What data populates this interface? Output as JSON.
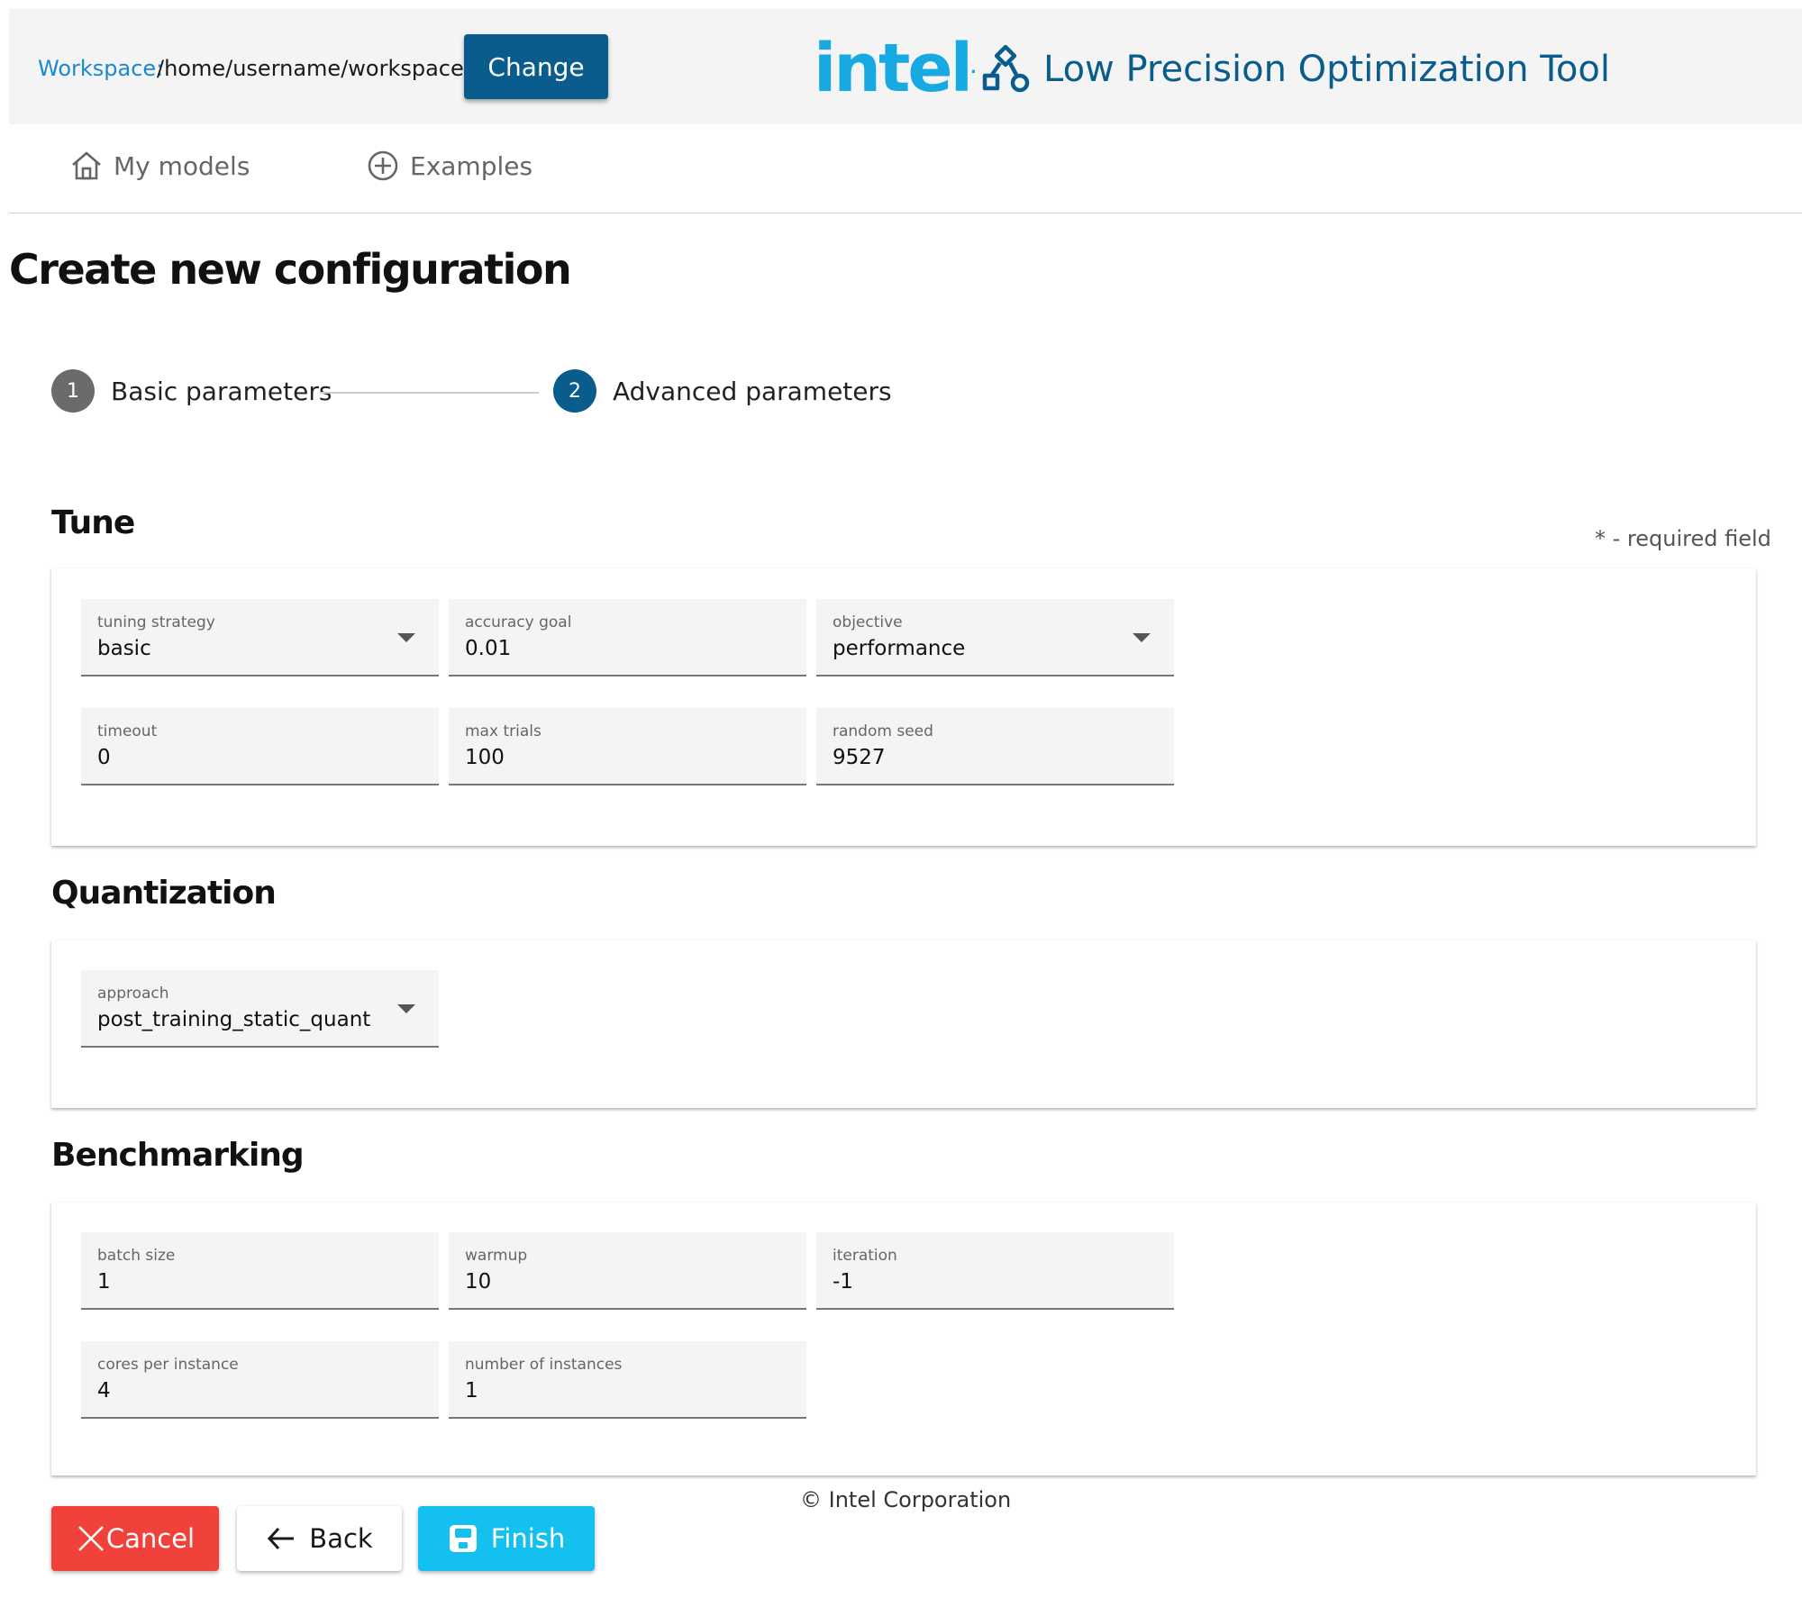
{
  "header": {
    "workspace_label": "Workspace:",
    "workspace_path": "/home/username/workspace",
    "change_label": "Change",
    "brand_logo": "intel",
    "app_title": "Low Precision Optimization Tool",
    "app_icon": "shapes-icon"
  },
  "nav": {
    "items": [
      {
        "label": "My models",
        "icon": "home-icon"
      },
      {
        "label": "Examples",
        "icon": "plus-circle-icon"
      }
    ]
  },
  "page": {
    "title": "Create new configuration",
    "required_note": "* - required field"
  },
  "stepper": {
    "steps": [
      {
        "number": "1",
        "label": "Basic parameters",
        "state": "inactive"
      },
      {
        "number": "2",
        "label": "Advanced parameters",
        "state": "active"
      }
    ]
  },
  "sections": {
    "tune": {
      "title": "Tune",
      "fields": {
        "tuning_strategy": {
          "label": "tuning strategy",
          "value": "basic",
          "type": "select"
        },
        "accuracy_goal": {
          "label": "accuracy goal",
          "value": "0.01",
          "type": "text"
        },
        "objective": {
          "label": "objective",
          "value": "performance",
          "type": "select"
        },
        "timeout": {
          "label": "timeout",
          "value": "0",
          "type": "text"
        },
        "max_trials": {
          "label": "max trials",
          "value": "100",
          "type": "text"
        },
        "random_seed": {
          "label": "random seed",
          "value": "9527",
          "type": "text"
        }
      }
    },
    "quantization": {
      "title": "Quantization",
      "fields": {
        "approach": {
          "label": "approach",
          "value": "post_training_static_quant",
          "type": "select"
        }
      }
    },
    "benchmarking": {
      "title": "Benchmarking",
      "fields": {
        "batch_size": {
          "label": "batch size",
          "value": "1",
          "type": "text"
        },
        "warmup": {
          "label": "warmup",
          "value": "10",
          "type": "text"
        },
        "iteration": {
          "label": "iteration",
          "value": "-1",
          "type": "text"
        },
        "cores_per_instance": {
          "label": "cores per instance",
          "value": "4",
          "type": "text"
        },
        "number_of_instances": {
          "label": "number of instances",
          "value": "1",
          "type": "text"
        }
      }
    }
  },
  "footer": {
    "copyright": "© Intel Corporation",
    "cancel_label": "Cancel",
    "back_label": "Back",
    "finish_label": "Finish"
  },
  "colors": {
    "brand_dark_blue": "#0a5c8c",
    "intel_blue": "#17a9e1",
    "workspace_label": "#1a8ad0",
    "cancel_red": "#f0413b",
    "finish_cyan": "#14c0f0",
    "step_inactive": "#6b6b6b",
    "step_active": "#0a5c8c"
  }
}
